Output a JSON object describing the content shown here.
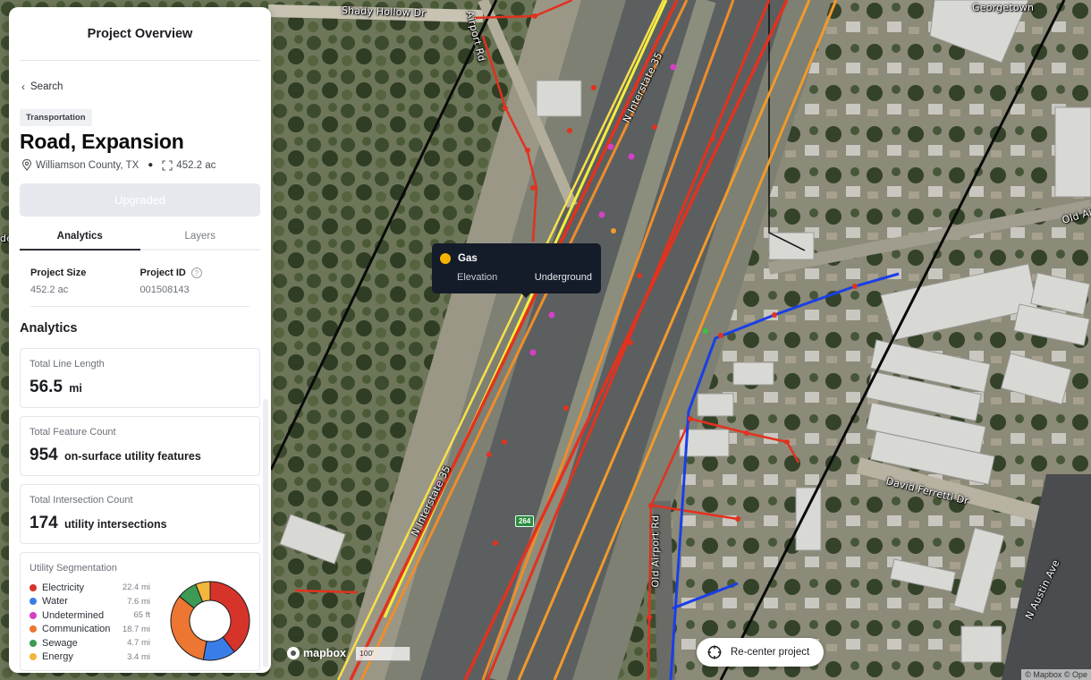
{
  "panel": {
    "header_title": "Project Overview",
    "back_label": "Search",
    "category_badge": "Transportation",
    "project_title": "Road, Expansion",
    "location": "Williamson County, TX",
    "area": "452.2 ac",
    "upgrade_button_label": "Upgraded",
    "tabs": [
      {
        "label": "Analytics",
        "active": true
      },
      {
        "label": "Layers",
        "active": false
      }
    ],
    "info": {
      "project_size_label": "Project Size",
      "project_size_value": "452.2 ac",
      "project_id_label": "Project ID",
      "project_id_value": "001508143"
    },
    "analytics_title": "Analytics",
    "cards": {
      "line_length": {
        "label": "Total Line Length",
        "value": "56.5",
        "unit": "mi"
      },
      "feature_count": {
        "label": "Total Feature Count",
        "value": "954",
        "unit": "on-surface utility features"
      },
      "intersection_count": {
        "label": "Total Intersection Count",
        "value": "174",
        "unit": "utility intersections"
      }
    },
    "segmentation": {
      "title": "Utility Segmentation",
      "items": [
        {
          "name": "Electricity",
          "value": "22.4 mi",
          "miles": 22.4,
          "color": "#d6342a"
        },
        {
          "name": "Water",
          "value": "7.6 mi",
          "miles": 7.6,
          "color": "#3b7de8"
        },
        {
          "name": "Undetermined",
          "value": "65 ft",
          "miles": 0.012,
          "color": "#d63fc4"
        },
        {
          "name": "Communication",
          "value": "18.7 mi",
          "miles": 18.7,
          "color": "#ec7632"
        },
        {
          "name": "Sewage",
          "value": "4.7 mi",
          "miles": 4.7,
          "color": "#3d9a55"
        },
        {
          "name": "Energy",
          "value": "3.4 mi",
          "miles": 3.4,
          "color": "#f2b63c"
        }
      ]
    }
  },
  "tooltip": {
    "title": "Gas",
    "color": "#f5b400",
    "row_label": "Elevation",
    "row_value": "Underground"
  },
  "map": {
    "recenter_label": "Re-center project",
    "logo_text": "mapbox",
    "scale_text": "100'",
    "attribution": "© Mapbox © Ope",
    "labels": {
      "shady_hollow": "Shady Hollow Dr",
      "airport_rd": "Airport Rd",
      "interstate_top": "N Interstate 35",
      "interstate_bottom": "N Interstate 35",
      "old_airport_rd": "Old Airport Rd",
      "old_air_right": "Old Air",
      "david_ferretti": "David Ferretti Dr",
      "n_austin_ave": "N Austin Ave",
      "georgetown": "Georgetown",
      "edge_fragment": "de"
    },
    "highway_shield": "264"
  }
}
